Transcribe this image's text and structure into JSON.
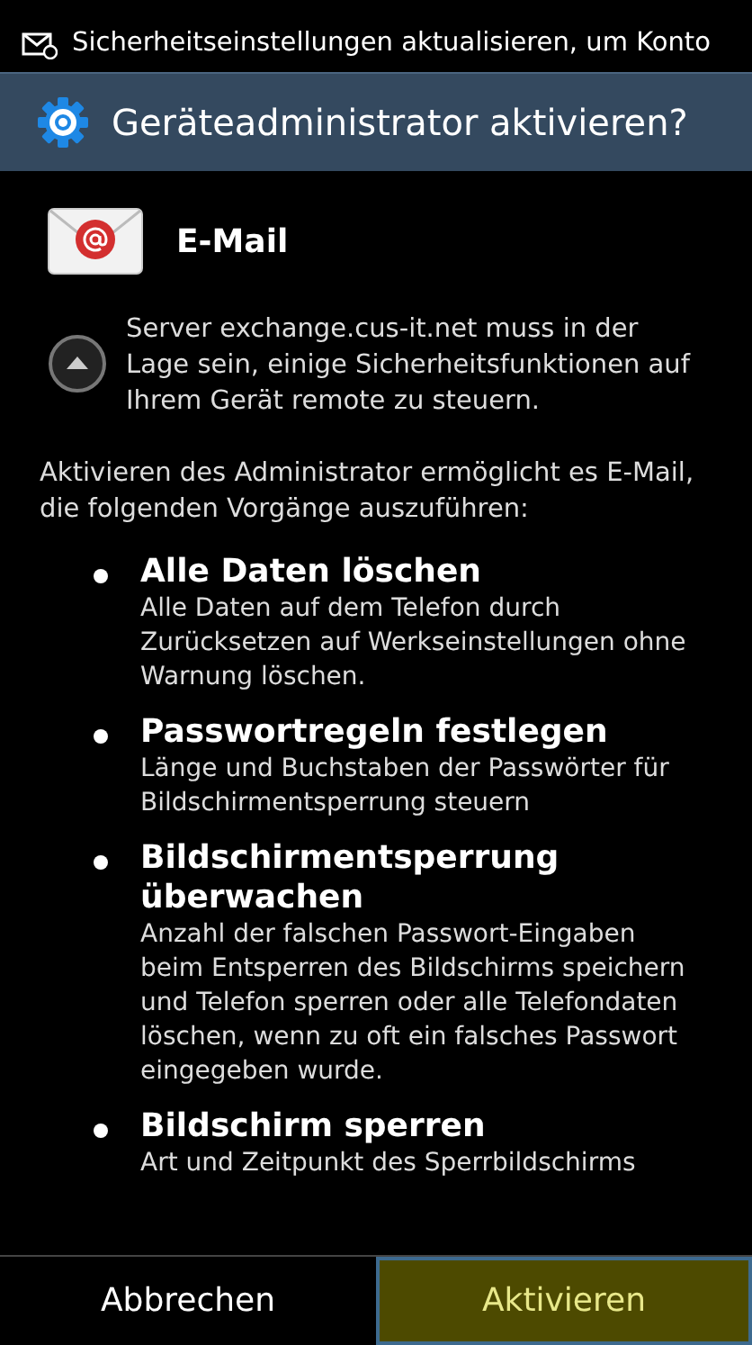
{
  "status_bar": {
    "notification": "Sicherheitseinstellungen aktualisieren, um Konto"
  },
  "dialog": {
    "title": "Geräteadministrator aktivieren?",
    "app_name": "E-Mail",
    "notice": "Server exchange.cus-it.net muss in der Lage sein, einige Sicherheitsfunktionen auf Ihrem Gerät remote zu steuern.",
    "intro": "Aktivieren des Administrator ermöglicht es E-Mail, die folgenden Vorgänge auszuführen:",
    "policies": [
      {
        "title": "Alle Daten löschen",
        "description": "Alle Daten auf dem Telefon durch Zurücksetzen auf Werkseinstellungen ohne Warnung löschen."
      },
      {
        "title": "Passwortregeln festlegen",
        "description": "Länge und Buchstaben der Passwörter für Bildschirmentsperrung steuern"
      },
      {
        "title": "Bildschirmentsperrung überwachen",
        "description": "Anzahl der falschen Passwort-Eingaben beim Entsperren des Bildschirms speichern und Telefon sperren oder alle Telefondaten löschen, wenn zu oft ein falsches Passwort eingegeben wurde."
      },
      {
        "title": "Bildschirm sperren",
        "description": "Art und Zeitpunkt des Sperrbildschirms"
      }
    ],
    "buttons": [
      {
        "label": "Abbrechen",
        "selected": false
      },
      {
        "label": "Aktivieren",
        "selected": true
      }
    ]
  }
}
